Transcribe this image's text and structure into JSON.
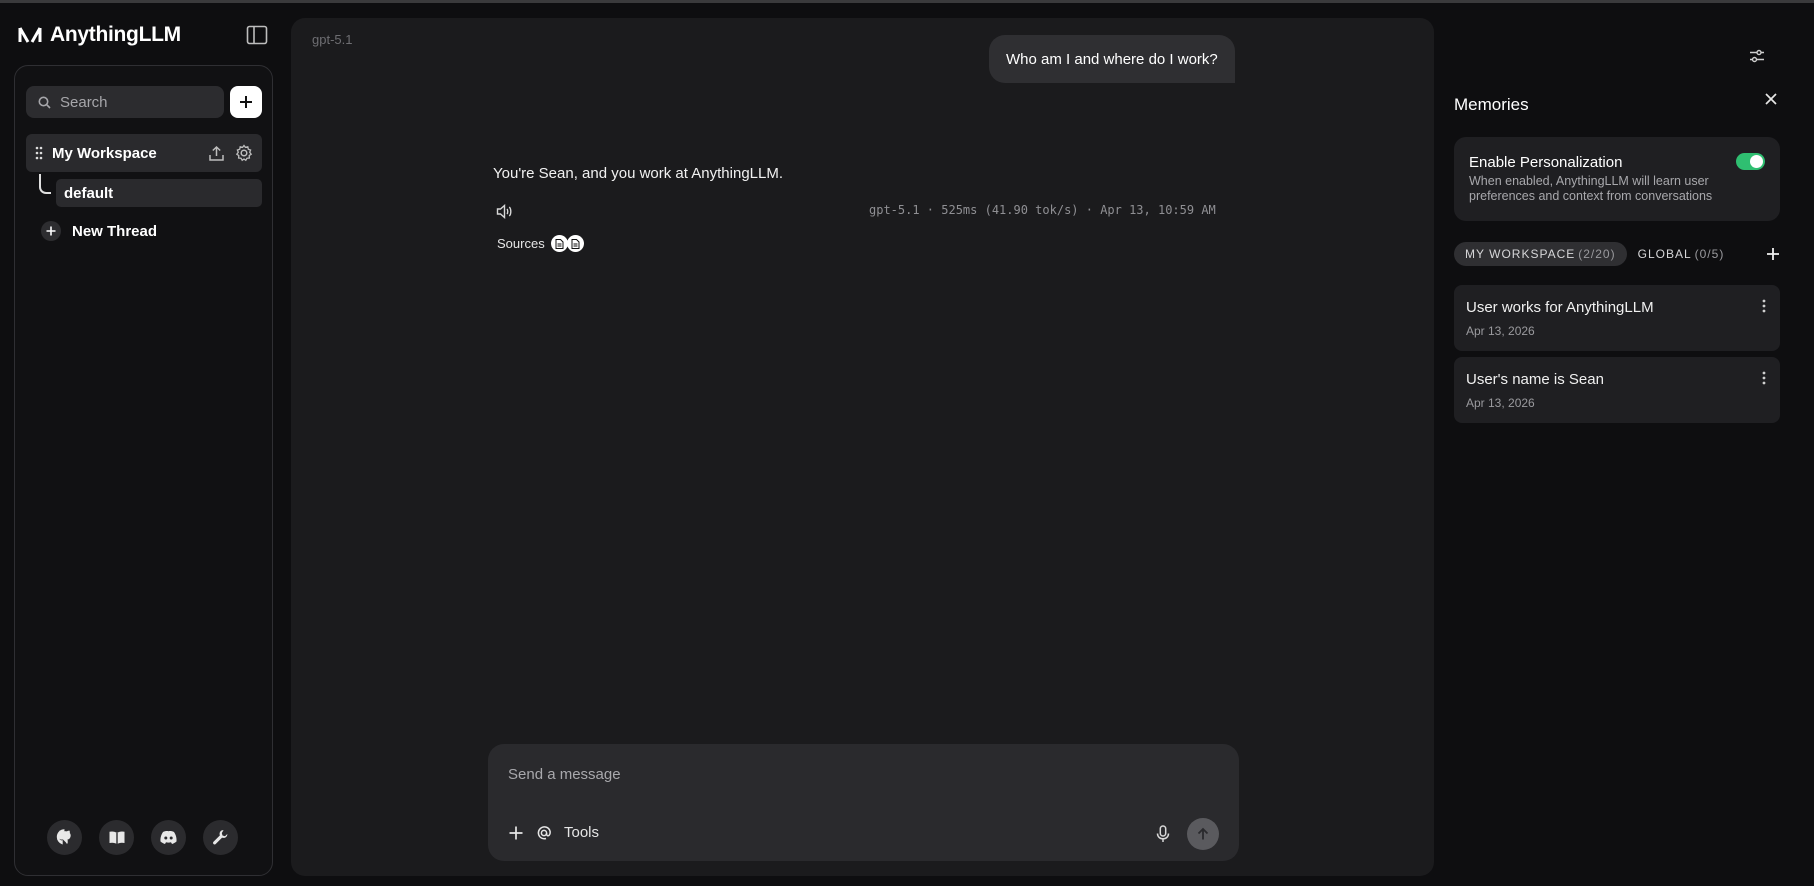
{
  "brand": {
    "name": "AnythingLLM"
  },
  "sidebar": {
    "search_placeholder": "Search",
    "workspace": {
      "name": "My Workspace"
    },
    "thread": {
      "name": "default"
    },
    "new_thread_label": "New Thread",
    "footer_icons": [
      "github-icon",
      "docs-book-icon",
      "discord-icon",
      "wrench-icon"
    ]
  },
  "chat": {
    "model_tag": "gpt-5.1",
    "user_message": "Who am I and where do I work?",
    "assistant_message": "You're Sean, and you work at AnythingLLM.",
    "meta": "gpt-5.1 · 525ms (41.90 tok/s) · Apr 13, 10:59 AM",
    "sources_label": "Sources",
    "composer_placeholder": "Send a message",
    "tools_label": "Tools"
  },
  "memories": {
    "title": "Memories",
    "personalization": {
      "title": "Enable Personalization",
      "description": "When enabled, AnythingLLM will learn user preferences and context from conversations",
      "enabled": true
    },
    "tabs": [
      {
        "label": "MY WORKSPACE",
        "count": "(2/20)",
        "active": true
      },
      {
        "label": "GLOBAL",
        "count": "(0/5)",
        "active": false
      }
    ],
    "items": [
      {
        "text": "User works for AnythingLLM",
        "date": "Apr 13, 2026"
      },
      {
        "text": "User's name is Sean",
        "date": "Apr 13, 2026"
      }
    ]
  },
  "colors": {
    "accent_toggle": "#2fbf71",
    "background": "#0e0e10",
    "panel": "#1b1b1d"
  }
}
